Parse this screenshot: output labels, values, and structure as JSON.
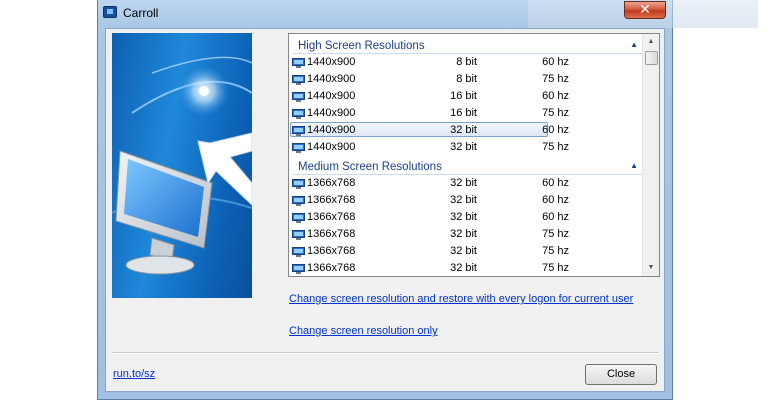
{
  "window": {
    "title": "Carroll",
    "close_glyph": "✕"
  },
  "groups": [
    {
      "label": "High Screen Resolutions",
      "rows": [
        {
          "resolution": "1440x900",
          "bits": "8 bit",
          "hz": "60 hz",
          "selected": false
        },
        {
          "resolution": "1440x900",
          "bits": "8 bit",
          "hz": "75 hz",
          "selected": false
        },
        {
          "resolution": "1440x900",
          "bits": "16 bit",
          "hz": "60 hz",
          "selected": false
        },
        {
          "resolution": "1440x900",
          "bits": "16 bit",
          "hz": "75 hz",
          "selected": false
        },
        {
          "resolution": "1440x900",
          "bits": "32 bit",
          "hz": "60 hz",
          "selected": true
        },
        {
          "resolution": "1440x900",
          "bits": "32 bit",
          "hz": "75 hz",
          "selected": false
        }
      ]
    },
    {
      "label": "Medium Screen Resolutions",
      "rows": [
        {
          "resolution": "1366x768",
          "bits": "32 bit",
          "hz": "60 hz",
          "selected": false
        },
        {
          "resolution": "1366x768",
          "bits": "32 bit",
          "hz": "60 hz",
          "selected": false
        },
        {
          "resolution": "1366x768",
          "bits": "32 bit",
          "hz": "60 hz",
          "selected": false
        },
        {
          "resolution": "1366x768",
          "bits": "32 bit",
          "hz": "75 hz",
          "selected": false
        },
        {
          "resolution": "1366x768",
          "bits": "32 bit",
          "hz": "75 hz",
          "selected": false
        },
        {
          "resolution": "1366x768",
          "bits": "32 bit",
          "hz": "75 hz",
          "selected": false
        }
      ]
    }
  ],
  "links": {
    "restore_every_logon": "Change screen resolution and restore with every logon for current user",
    "change_only": "Change screen resolution only",
    "footer": "run.to/sz"
  },
  "buttons": {
    "close": "Close"
  },
  "icons": {
    "app": "monitor-app-icon",
    "row": "monitor-icon",
    "collapse": "chevron-up-icon"
  },
  "colors": {
    "accent_link": "#0033cc",
    "group_header": "#1e3f8c",
    "banner_blue": "#1f88d9"
  }
}
